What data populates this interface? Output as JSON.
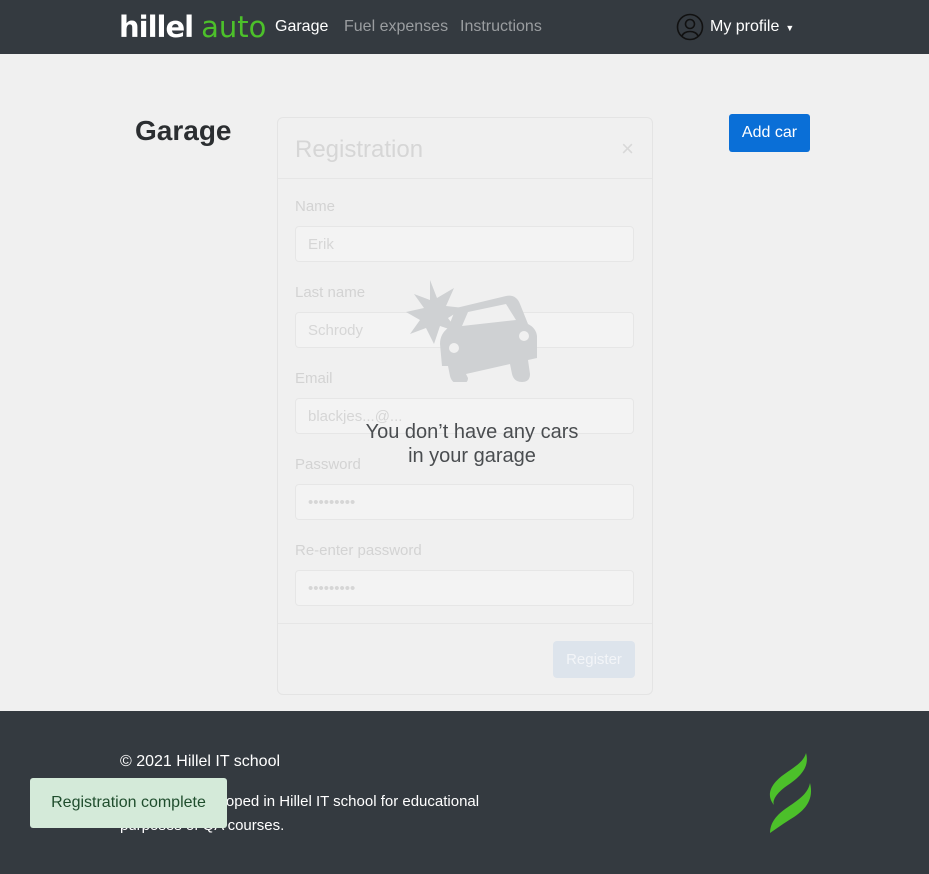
{
  "nav": {
    "logo_left": "hillel",
    "logo_right": "auto",
    "links": [
      {
        "label": "Garage",
        "active": true
      },
      {
        "label": "Fuel expenses",
        "active": false
      },
      {
        "label": "Instructions",
        "active": false
      }
    ],
    "profile_label": "My profile"
  },
  "page": {
    "title": "Garage",
    "add_car_label": "Add car",
    "empty_line1": "You don’t have any cars",
    "empty_line2": "in your garage"
  },
  "modal": {
    "title": "Registration",
    "close": "×",
    "fields": [
      {
        "label": "Name",
        "value": "Erik"
      },
      {
        "label": "Last name",
        "value": "Schrody"
      },
      {
        "label": "Email",
        "value": "blackjes...@..."
      },
      {
        "label": "Password",
        "value": "•••••••••"
      },
      {
        "label": "Re-enter password",
        "value": "•••••••••"
      }
    ],
    "register_label": "Register"
  },
  "footer": {
    "copyright": "© 2021 Hillel IT school",
    "description": "Hillel auto developed in Hillel IT school for educational purposes of QA courses."
  },
  "toast": {
    "text": "Registration complete"
  },
  "colors": {
    "nav_bg": "#343a40",
    "accent_green": "#4cc02a",
    "primary_blue": "#0a6fd7"
  }
}
